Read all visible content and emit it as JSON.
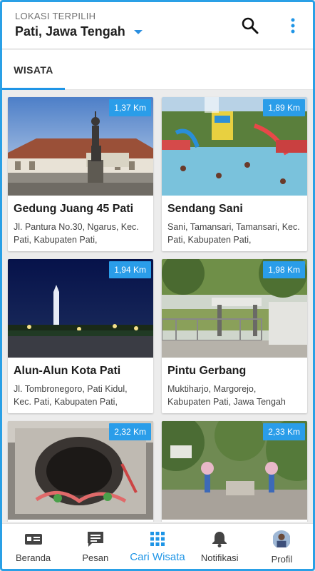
{
  "header": {
    "location_caption": "LOKASI TERPILIH",
    "location_value": "Pati, Jawa Tengah",
    "search_icon": "search-icon",
    "more_icon": "more-vert-icon"
  },
  "tabs": [
    {
      "label": "WISATA",
      "active": true
    }
  ],
  "places": [
    {
      "distance": "1,37 Km",
      "name": "Gedung Juang 45 Pati",
      "address": "Jl. Pantura No.30, Ngarus, Kec. Pati, Kabupaten Pati,"
    },
    {
      "distance": "1,89 Km",
      "name": "Sendang Sani",
      "address": "Sani, Tamansari, Tamansari, Kec. Pati, Kabupaten Pati,"
    },
    {
      "distance": "1,94 Km",
      "name": "Alun-Alun Kota Pati",
      "address": "Jl. Tombronegoro, Pati Kidul, Kec. Pati, Kabupaten Pati,"
    },
    {
      "distance": "1,98 Km",
      "name": "Pintu Gerbang",
      "address": "Muktiharjo, Margorejo, Kabupaten Pati, Jawa Tengah"
    },
    {
      "distance": "2,32 Km",
      "name": "",
      "address": ""
    },
    {
      "distance": "2,33 Km",
      "name": "",
      "address": ""
    }
  ],
  "bottom_nav": [
    {
      "label": "Beranda",
      "icon": "home-card-icon",
      "active": false
    },
    {
      "label": "Pesan",
      "icon": "message-icon",
      "active": false
    },
    {
      "label": "Cari Wisata",
      "icon": "grid-icon",
      "active": true
    },
    {
      "label": "Notifikasi",
      "icon": "bell-icon",
      "active": false
    },
    {
      "label": "Profil",
      "icon": "avatar",
      "active": false
    }
  ],
  "colors": {
    "accent": "#1f95e6",
    "badge": "#2a9de9"
  }
}
